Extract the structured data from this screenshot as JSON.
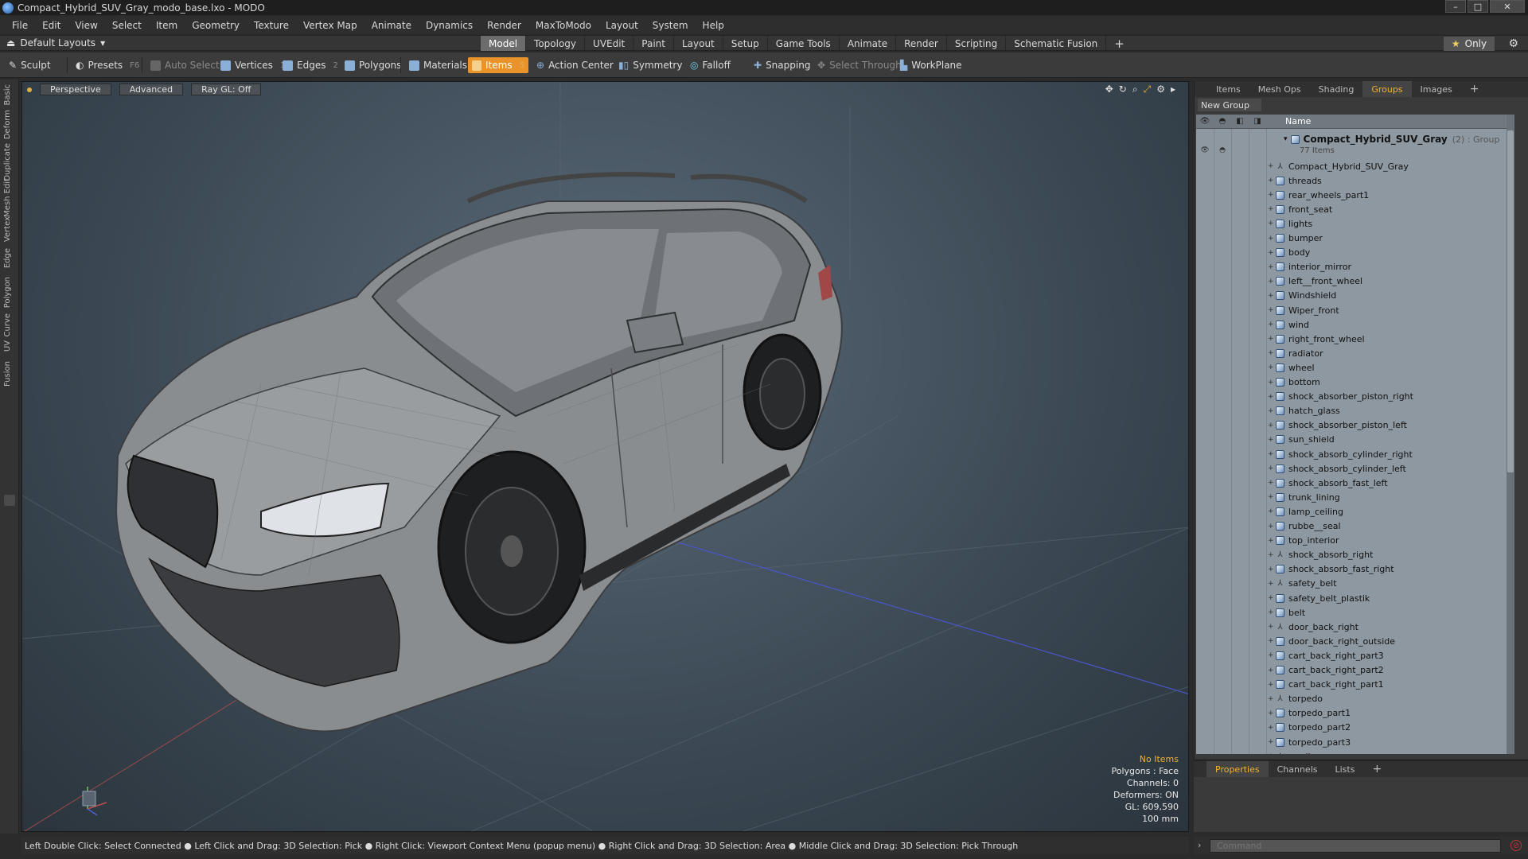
{
  "window": {
    "title": "Compact_Hybrid_SUV_Gray_modo_base.lxo - MODO"
  },
  "menu": [
    "File",
    "Edit",
    "View",
    "Select",
    "Item",
    "Geometry",
    "Texture",
    "Vertex Map",
    "Animate",
    "Dynamics",
    "Render",
    "MaxToModo",
    "Layout",
    "System",
    "Help"
  ],
  "layout": {
    "select_label": "Default Layouts",
    "tabs": [
      "Model",
      "Topology",
      "UVEdit",
      "Paint",
      "Layout",
      "Setup",
      "Game Tools",
      "Animate",
      "Render",
      "Scripting",
      "Schematic Fusion",
      "+"
    ],
    "active_tab": "Model",
    "only_label": "Only"
  },
  "toolbar": {
    "sculpt": "Sculpt",
    "presets": "Presets",
    "presets_key": "F6",
    "auto_select": "Auto Select",
    "vertices": "Vertices",
    "vertices_count": "1",
    "edges": "Edges",
    "edges_count": "2",
    "polygons": "Polygons",
    "materials": "Materials",
    "items": "Items",
    "items_count": "5",
    "action_center": "Action Center",
    "symmetry": "Symmetry",
    "falloff": "Falloff",
    "snapping": "Snapping",
    "select_through": "Select Through",
    "workplane": "WorkPlane"
  },
  "left_tabs": [
    "Basic",
    "Deform",
    "Duplicate",
    "Mesh Edit",
    "Vertex",
    "Edge",
    "Polygon",
    "Curve",
    "UV",
    "Fusion"
  ],
  "viewport": {
    "perspective": "Perspective",
    "advanced": "Advanced",
    "ray_gl": "Ray GL: Off",
    "info": {
      "no_items": "No Items",
      "polygons": "Polygons : Face",
      "channels": "Channels: 0",
      "deformers": "Deformers: ON",
      "gl": "GL: 609,590",
      "scale": "100 mm"
    }
  },
  "right_panel": {
    "tabs": [
      "Items",
      "Mesh Ops",
      "Shading",
      "Groups",
      "Images",
      "+"
    ],
    "active_tab": "Groups",
    "new_group": "New Group",
    "column_name": "Name",
    "group": {
      "name": "Compact_Hybrid_SUV_Gray",
      "meta": "(2) : Group",
      "count": "77 Items"
    },
    "items": [
      {
        "name": "Compact_Hybrid_SUV_Gray",
        "icon": "locator"
      },
      {
        "name": "threads",
        "icon": "mesh"
      },
      {
        "name": "rear_wheels_part1",
        "icon": "mesh"
      },
      {
        "name": "front_seat",
        "icon": "mesh"
      },
      {
        "name": "lights",
        "icon": "mesh"
      },
      {
        "name": "bumper",
        "icon": "mesh"
      },
      {
        "name": "body",
        "icon": "mesh"
      },
      {
        "name": "interior_mirror",
        "icon": "mesh"
      },
      {
        "name": "left__front_wheel",
        "icon": "mesh"
      },
      {
        "name": "Windshield",
        "icon": "mesh"
      },
      {
        "name": "Wiper_front",
        "icon": "mesh"
      },
      {
        "name": "wind",
        "icon": "mesh"
      },
      {
        "name": "right_front_wheel",
        "icon": "mesh"
      },
      {
        "name": "radiator",
        "icon": "mesh"
      },
      {
        "name": "wheel",
        "icon": "mesh"
      },
      {
        "name": "bottom",
        "icon": "mesh"
      },
      {
        "name": "shock_absorber_piston_right",
        "icon": "mesh"
      },
      {
        "name": "hatch_glass",
        "icon": "mesh"
      },
      {
        "name": "shock_absorber_piston_left",
        "icon": "mesh"
      },
      {
        "name": "sun_shield",
        "icon": "mesh"
      },
      {
        "name": "shock_absorb_cylinder_right",
        "icon": "mesh"
      },
      {
        "name": "shock_absorb_cylinder_left",
        "icon": "mesh"
      },
      {
        "name": "shock_absorb_fast_left",
        "icon": "mesh"
      },
      {
        "name": "trunk_lining",
        "icon": "mesh"
      },
      {
        "name": "lamp_ceiling",
        "icon": "mesh"
      },
      {
        "name": "rubbe__seal",
        "icon": "mesh"
      },
      {
        "name": "top_interior",
        "icon": "mesh"
      },
      {
        "name": "shock_absorb_right",
        "icon": "locator"
      },
      {
        "name": "shock_absorb_fast_right",
        "icon": "mesh"
      },
      {
        "name": "safety_belt",
        "icon": "locator"
      },
      {
        "name": "safety_belt_plastik",
        "icon": "mesh"
      },
      {
        "name": "belt",
        "icon": "mesh"
      },
      {
        "name": "door_back_right",
        "icon": "locator"
      },
      {
        "name": "door_back_right_outside",
        "icon": "mesh"
      },
      {
        "name": "cart_back_right_part3",
        "icon": "mesh"
      },
      {
        "name": "cart_back_right_part2",
        "icon": "mesh"
      },
      {
        "name": "cart_back_right_part1",
        "icon": "mesh"
      },
      {
        "name": "torpedo",
        "icon": "locator"
      },
      {
        "name": "torpedo_part1",
        "icon": "mesh"
      },
      {
        "name": "torpedo_part2",
        "icon": "mesh"
      },
      {
        "name": "torpedo_part3",
        "icon": "mesh"
      },
      {
        "name": "medium",
        "icon": "locator"
      }
    ]
  },
  "properties": {
    "tabs": [
      "Properties",
      "Channels",
      "Lists",
      "+"
    ],
    "active_tab": "Properties"
  },
  "status": {
    "text": "Left Double Click: Select Connected ● Left Click and Drag: 3D Selection: Pick ● Right Click: Viewport Context Menu (popup menu) ● Right Click and Drag: 3D Selection: Area ● Middle Click and Drag: 3D Selection: Pick Through"
  },
  "command": {
    "placeholder": "Command"
  },
  "colors": {
    "accent": "#e8942a",
    "groups_tab": "#f0b030",
    "list_bg": "#8e98a0"
  }
}
